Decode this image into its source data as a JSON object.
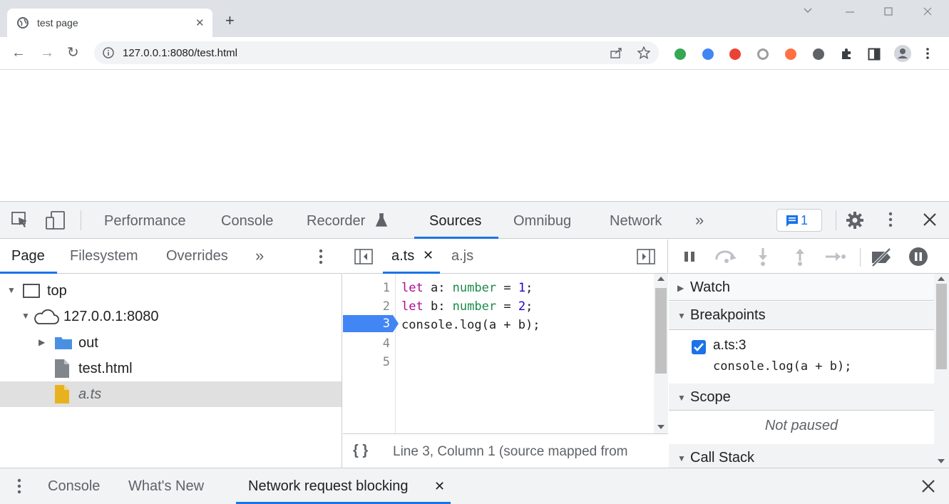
{
  "browser": {
    "tab_title": "test page",
    "tab_close": "✕",
    "new_tab": "+",
    "url": "127.0.0.1:8080/test.html",
    "window_controls": {
      "minimize": "—",
      "maximize": "☐",
      "close": "✕",
      "chevron": "⌄"
    },
    "nav": {
      "back": "←",
      "forward": "→",
      "reload": "↻"
    },
    "extension_colors": [
      "#34a853",
      "#4285f4",
      "#ea4335",
      "#9e9e9e",
      "#ff7043",
      "#5f6368"
    ]
  },
  "devtools": {
    "tabs": [
      {
        "label": "Performance"
      },
      {
        "label": "Console"
      },
      {
        "label": "Recorder"
      },
      {
        "label": "Sources"
      },
      {
        "label": "Omnibug"
      },
      {
        "label": "Network"
      }
    ],
    "more_tabs": "»",
    "issues_count": "1",
    "close": "✕",
    "accent_color": "#1a73e8",
    "navigator": {
      "tabs": [
        "Page",
        "Filesystem",
        "Overrides"
      ],
      "more": "»",
      "tree": [
        {
          "label": "top"
        },
        {
          "label": "127.0.0.1:8080"
        },
        {
          "label": "out"
        },
        {
          "label": "test.html"
        },
        {
          "label": "a.ts"
        }
      ]
    },
    "editor": {
      "tabs": [
        "a.ts",
        "a.js"
      ],
      "tab_close": "✕",
      "line_numbers": [
        "1",
        "2",
        "3",
        "4",
        "5"
      ],
      "breakpoint_line": "3",
      "code": {
        "l1_kw": "let",
        "l1_var": " a: ",
        "l1_type": "number",
        "l1_eq": " = ",
        "l1_num": "1",
        "l1_end": ";",
        "l2_kw": "let",
        "l2_var": " b: ",
        "l2_type": "number",
        "l2_eq": " = ",
        "l2_num": "2",
        "l2_end": ";",
        "l3": "console.log(a + b);"
      },
      "pretty_print": "{ }",
      "status": "Line 3, Column 1  (source mapped from"
    },
    "debugger": {
      "panes": [
        "Watch",
        "Breakpoints",
        "Scope",
        "Call Stack"
      ],
      "breakpoint_location": "a.ts:3",
      "breakpoint_code": "console.log(a + b);",
      "scope_status": "Not paused"
    },
    "drawer": {
      "tabs": [
        "Console",
        "What's New",
        "Network request blocking"
      ],
      "tab_close": "✕",
      "close": "✕"
    }
  }
}
